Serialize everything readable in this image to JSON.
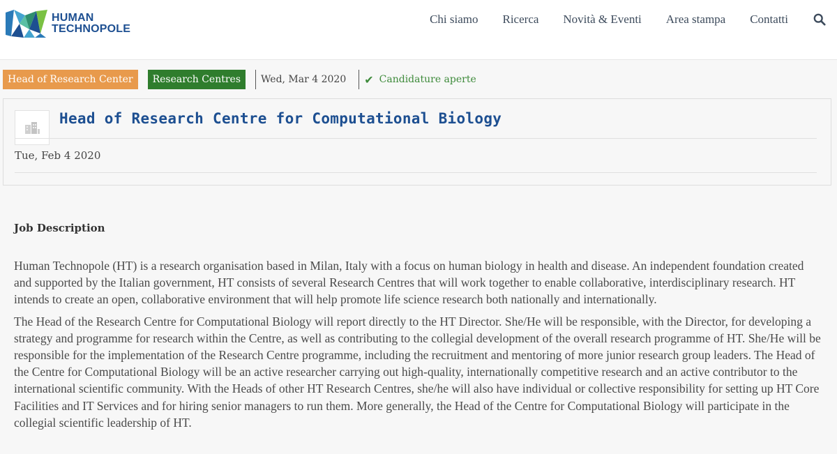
{
  "header": {
    "logo": {
      "line1": "HUMAN",
      "line2": "TECHNOPOLE"
    },
    "nav": [
      {
        "label": "Chi siamo"
      },
      {
        "label": "Ricerca"
      },
      {
        "label": "Novità & Eventi"
      },
      {
        "label": "Area stampa"
      },
      {
        "label": "Contatti"
      }
    ],
    "search_icon": "search-icon"
  },
  "tags": {
    "category": "Head of Research Center",
    "section": "Research Centres",
    "date": "Wed, Mar 4 2020",
    "status": "Candidature aperte",
    "status_icon": "check-icon"
  },
  "card": {
    "title": "Head of Research Centre for Computational Biology",
    "date": "Tue, Feb 4 2020",
    "thumb_icon": "building-icon"
  },
  "content": {
    "heading": "Job Description",
    "paragraphs": [
      "Human Technopole (HT) is a research organisation based in Milan, Italy with a focus on human biology in health and disease. An independent foundation created and supported by the Italian government, HT consists of several Research Centres that will work together to enable collaborative, interdisciplinary research. HT intends to create an open, collaborative environment that will help promote life science research both nationally and internationally.",
      "The Head of the Research Centre for Computational Biology will report directly to the HT Director. She/He will be responsible, with the Director, for developing a strategy and programme for research within the Centre, as well as contributing to the collegial development of the overall research programme of HT. She/He will be responsible for the implementation of the Research Centre programme, including the recruitment and mentoring of more junior research group leaders. The Head of the Centre for Computational Biology will be an active researcher carrying out high-quality, internationally competitive research and an active contributor to the international scientific community. With the Heads of other HT Research Centres, she/he will also have individual or collective responsibility for setting up HT Core Facilities and IT Services and for hiring senior managers to run them. More generally, the Head of the Centre for Computational Biology will participate in the collegial scientific leadership of HT."
    ]
  },
  "colors": {
    "brand_blue": "#1d4f91",
    "tag_orange": "#e89a4c",
    "tag_green": "#2f7d2d",
    "status_green": "#3d8a3a"
  }
}
